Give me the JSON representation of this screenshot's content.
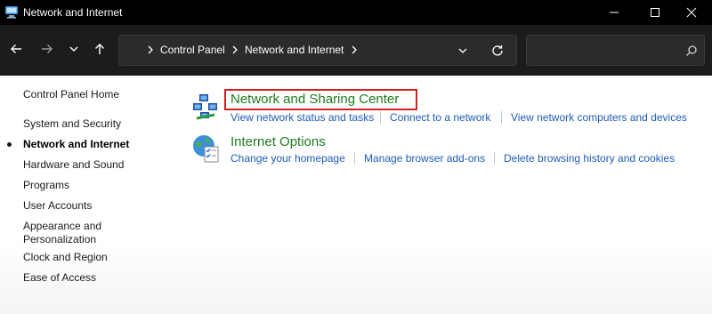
{
  "window": {
    "title": "Network and Internet",
    "icon": "control-panel-icon"
  },
  "address_bar": {
    "crumbs": [
      "Control Panel",
      "Network and Internet"
    ],
    "search_placeholder": ""
  },
  "sidebar": {
    "items": [
      {
        "label": "Control Panel Home"
      },
      {
        "label": "System and Security"
      },
      {
        "label": "Network and Internet",
        "active": true
      },
      {
        "label": "Hardware and Sound"
      },
      {
        "label": "Programs"
      },
      {
        "label": "User Accounts"
      },
      {
        "label": "Appearance and",
        "label2": "Personalization"
      },
      {
        "label": "Clock and Region"
      },
      {
        "label": "Ease of Access"
      }
    ]
  },
  "categories": [
    {
      "title": "Network and Sharing Center",
      "icon": "network-sharing-icon",
      "highlighted": true,
      "tasks": [
        "View network status and tasks",
        "Connect to a network",
        "View network computers and devices"
      ]
    },
    {
      "title": "Internet Options",
      "icon": "internet-options-icon",
      "highlighted": false,
      "tasks": [
        "Change your homepage",
        "Manage browser add-ons",
        "Delete browsing history and cookies"
      ]
    }
  ],
  "colors": {
    "titlebar": "#000000",
    "navbar": "#1c1c1c",
    "category_title": "#1e7a1e",
    "task_link": "#1e5bb8",
    "highlight_border": "#d42020"
  }
}
